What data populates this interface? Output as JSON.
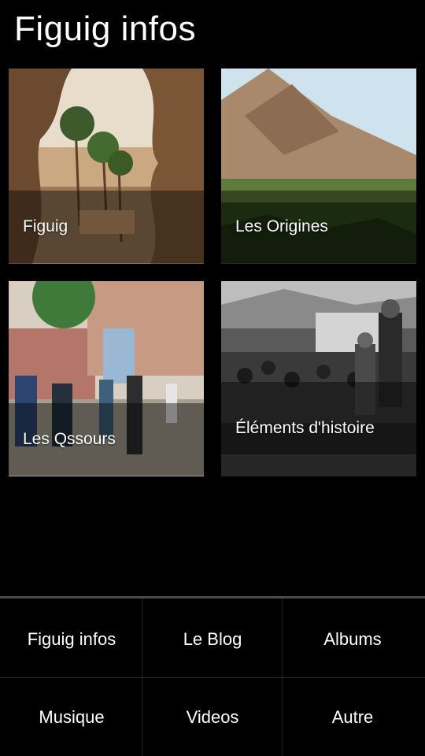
{
  "app": {
    "title": "Figuig infos"
  },
  "tiles": [
    {
      "label": "Figuig"
    },
    {
      "label": "Les Origines"
    },
    {
      "label": "Les Qssours"
    },
    {
      "label": "Éléments d'histoire"
    }
  ],
  "menu": {
    "items": [
      {
        "label": "Figuig infos"
      },
      {
        "label": "Le Blog"
      },
      {
        "label": "Albums"
      },
      {
        "label": "Musique"
      },
      {
        "label": "Videos"
      },
      {
        "label": "Autre"
      }
    ]
  },
  "colors": {
    "background": "#000000",
    "text": "#ffffff",
    "divider": "#4a4a4a"
  }
}
